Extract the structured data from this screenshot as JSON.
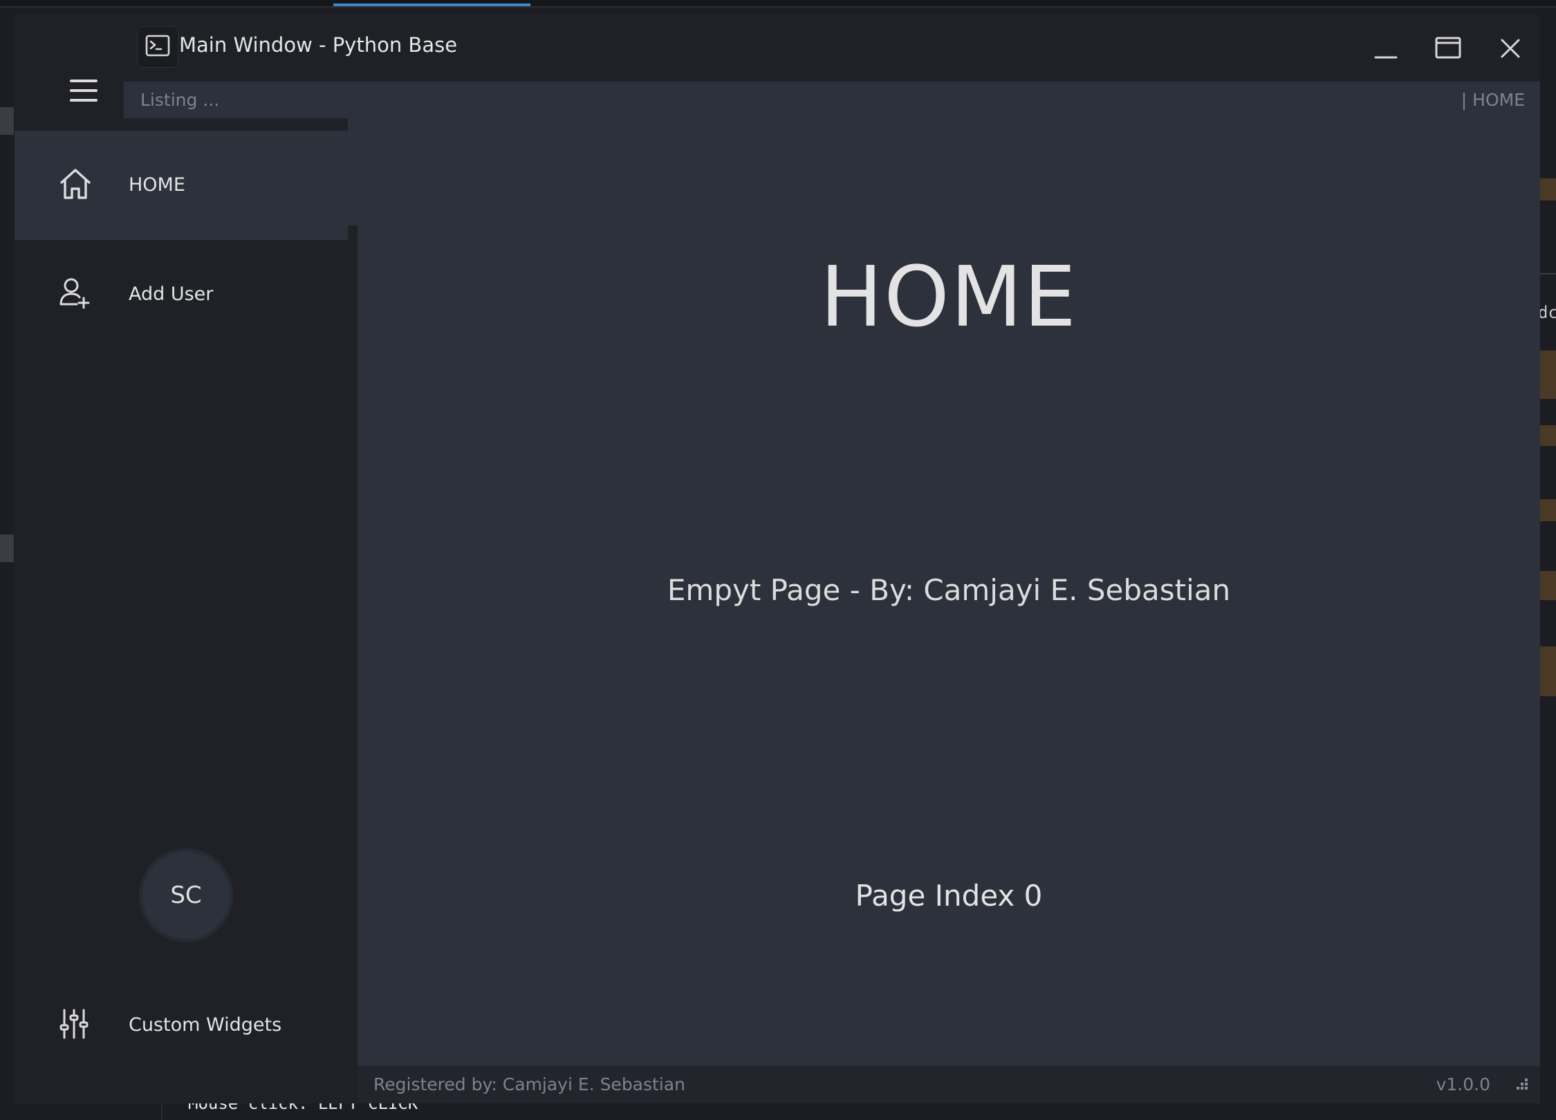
{
  "window": {
    "title": "Main Window - Python Base",
    "icon": "terminal-icon",
    "controls": [
      "minimize-icon",
      "maximize-icon",
      "close-icon"
    ]
  },
  "menu": {
    "toggle_icon": "hamburger-icon",
    "items": [
      {
        "label": "HOME",
        "icon": "home-icon",
        "active": true
      },
      {
        "label": "Add User",
        "icon": "add-user-icon",
        "active": false
      }
    ],
    "user_initials": "SC",
    "settings": {
      "label": "Custom Widgets",
      "icon": "sliders-icon"
    }
  },
  "top_info": {
    "left_text": "Listing ...",
    "right_text": "| HOME"
  },
  "page": {
    "title": "HOME",
    "subtitle": "Empyt Page - By: Camjayi E. Sebastian",
    "index_label": "Page Index 0"
  },
  "footer": {
    "credits": "Registered by: Camjayi E. Sebastian",
    "version": "v1.0.0"
  },
  "background": {
    "right_fragment": "dc",
    "terminal_line": "Mouse click: LEFT CLICK"
  },
  "colors": {
    "menu_bg": "#1f2127",
    "content_bg": "#2c313c",
    "footer_bg": "#22252c",
    "muted_text": "#7d828c",
    "accent_tab": "#3f86c7"
  }
}
